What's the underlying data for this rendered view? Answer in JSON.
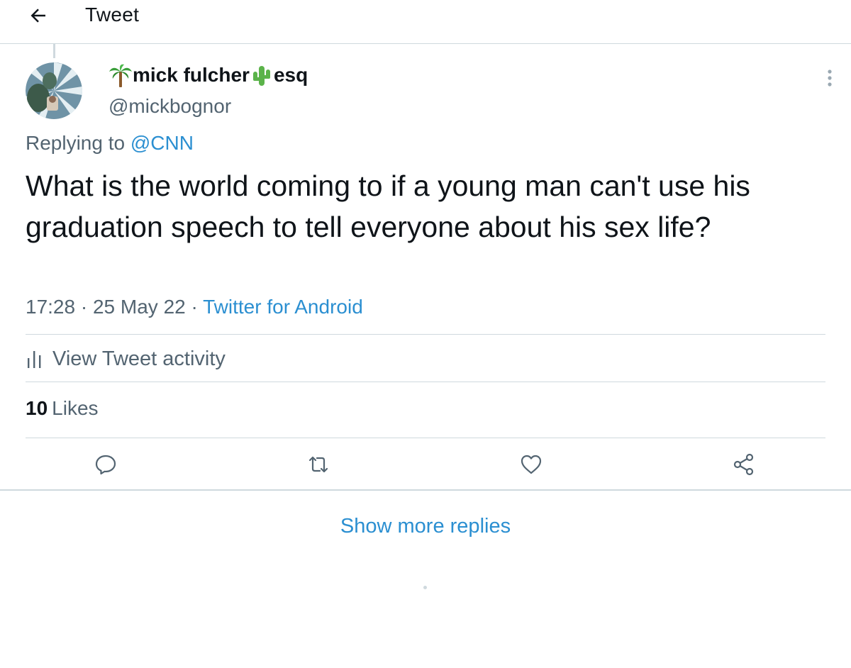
{
  "header": {
    "title": "Tweet"
  },
  "tweet": {
    "author": {
      "name_part1": "mick fulcher",
      "name_part2": "esq",
      "handle": "@mickbognor"
    },
    "reply_prefix": "Replying to ",
    "reply_mention": "@CNN",
    "text": "What is the world coming to if a young man can't use his graduation speech to tell everyone about his sex life?",
    "time": "17:28",
    "separator": " · ",
    "date": "25 May 22",
    "source": "Twitter for Android",
    "activity_label": "View Tweet activity",
    "likes_count": "10",
    "likes_label": "Likes"
  },
  "show_more": "Show more replies",
  "icons": {
    "back": "arrow-left-icon",
    "more": "more-vertical-icon",
    "activity": "bar-chart-icon",
    "reply": "reply-icon",
    "retweet": "retweet-icon",
    "like": "heart-icon",
    "share": "share-icon"
  },
  "colors": {
    "link": "#2b8fd1",
    "secondary_text": "#536471",
    "primary_text": "#0f1419",
    "border": "#cfd9de"
  }
}
